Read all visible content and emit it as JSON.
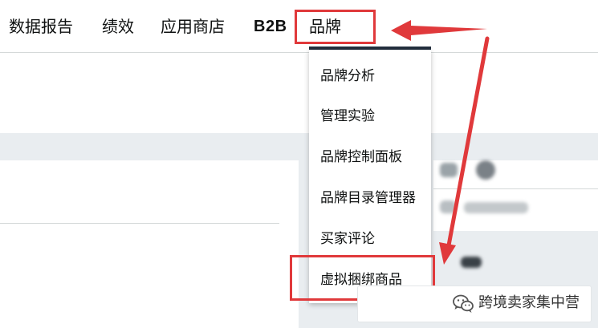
{
  "nav": {
    "items": [
      {
        "label": "数据报告"
      },
      {
        "label": "绩效"
      },
      {
        "label": "应用商店"
      },
      {
        "label": "B2B"
      },
      {
        "label": "品牌"
      }
    ]
  },
  "brand_menu": {
    "items": [
      {
        "label": "品牌分析"
      },
      {
        "label": "管理实验"
      },
      {
        "label": "品牌控制面板"
      },
      {
        "label": "品牌目录管理器"
      },
      {
        "label": "买家评论"
      },
      {
        "label": "虚拟捆绑商品"
      }
    ]
  },
  "watermark": {
    "text": "跨境卖家集中营",
    "icon": "wechat-icon"
  },
  "colors": {
    "highlight": "#e0393b",
    "nav_underline": "#232f3e",
    "text": "#0f1111",
    "background_band": "#e9edf0"
  }
}
